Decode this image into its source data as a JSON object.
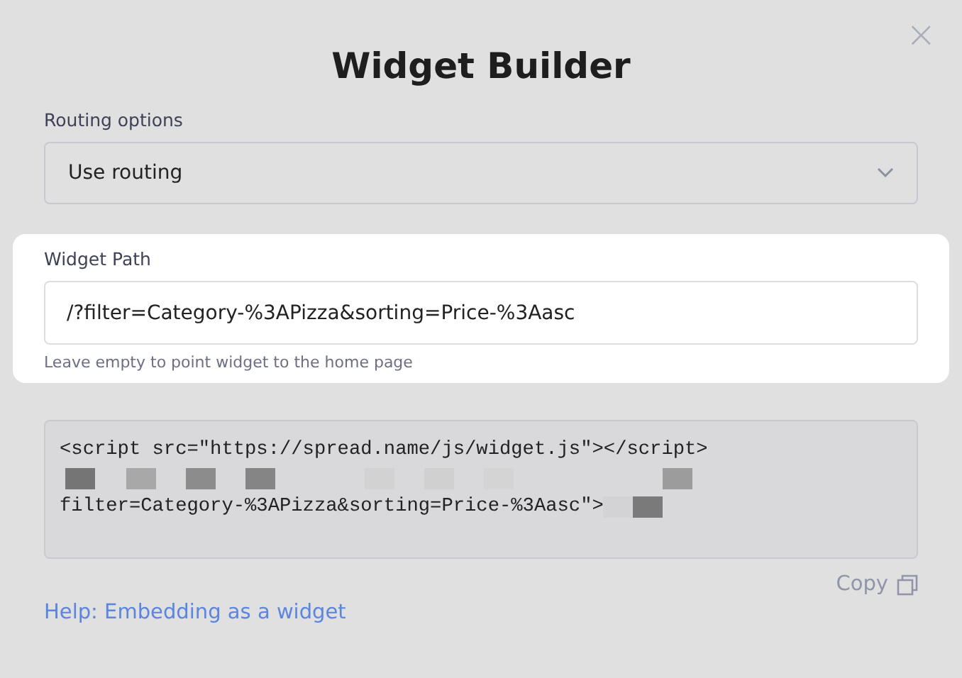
{
  "dialog": {
    "title": "Widget Builder",
    "close": "×"
  },
  "routing": {
    "label": "Routing options",
    "value": "Use routing"
  },
  "widget_path": {
    "highlighted": true,
    "label": "Widget Path",
    "value": "/?filter=Category-%3APizza&sorting=Price-%3Aasc",
    "hint": "Leave empty to point widget to the home page"
  },
  "code": {
    "lines": [
      {
        "kind": "text",
        "text": "<script src=\"https://spread.name/js/widget.js\"></script>"
      },
      {
        "kind": "redacted"
      },
      {
        "kind": "text",
        "text": "filter=Category-%3APizza&sorting=Price-%3Aasc\">",
        "redacted_tail": true
      }
    ]
  },
  "copy": {
    "label": "Copy"
  },
  "help_link": "Help: Embedding as a widget"
}
